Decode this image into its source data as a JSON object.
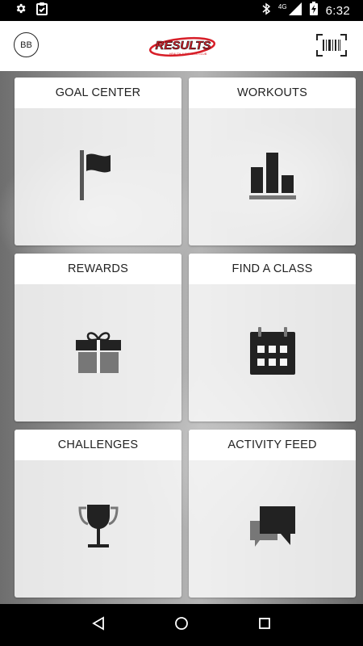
{
  "status_bar": {
    "time": "6:32",
    "network": "4G",
    "icons": [
      "settings-icon",
      "clipboard-check-icon",
      "bluetooth-icon",
      "signal-icon",
      "battery-charging-icon"
    ]
  },
  "header": {
    "avatar_initials": "BB",
    "logo_text": "RESULTS",
    "logo_subtext": "HEALTH & FITNESS CLUB",
    "barcode_icon": "barcode-icon"
  },
  "tiles": [
    {
      "label": "GOAL CENTER",
      "icon": "flag-icon"
    },
    {
      "label": "WORKOUTS",
      "icon": "bar-chart-icon"
    },
    {
      "label": "REWARDS",
      "icon": "gift-icon"
    },
    {
      "label": "FIND A CLASS",
      "icon": "calendar-icon"
    },
    {
      "label": "CHALLENGES",
      "icon": "trophy-icon"
    },
    {
      "label": "ACTIVITY FEED",
      "icon": "chat-bubbles-icon"
    }
  ],
  "nav_bar": {
    "icons": [
      "back-icon",
      "home-icon",
      "recents-icon"
    ]
  },
  "colors": {
    "brand_red": "#d71e28",
    "icon_dark": "#222222",
    "icon_gray": "#777777"
  }
}
